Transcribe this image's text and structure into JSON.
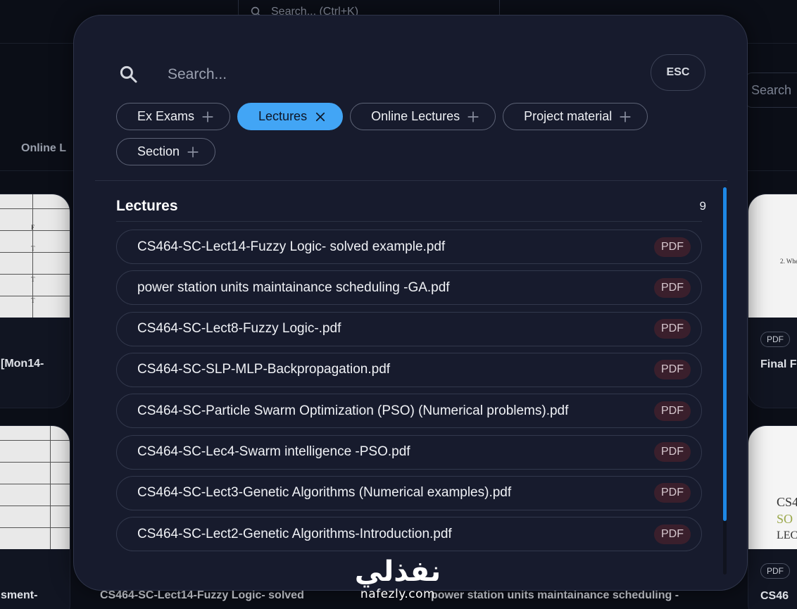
{
  "background": {
    "search_placeholder": "Search... (Ctrl+K)",
    "search2_placeholder": "Search",
    "tab_left": "Online L",
    "card_left_top_title": "[Mon14-",
    "card_right_top_title": "Final F",
    "card_left_bottom_title": "sment-",
    "card_right_bottom_title": "CS46",
    "pdf_chip": "PDF",
    "bottom_text_1": "CS464-SC-Lect14-Fuzzy Logic- solved",
    "bottom_text_2": "power station units maintainance scheduling -"
  },
  "watermark": {
    "arabic": "نفذلي",
    "latin": "nafezly.com"
  },
  "modal": {
    "search_placeholder": "Search...",
    "esc_label": "ESC",
    "chips": [
      {
        "label": "Ex Exams",
        "active": false,
        "icon": "plus-icon"
      },
      {
        "label": "Lectures",
        "active": true,
        "icon": "close-icon"
      },
      {
        "label": "Online Lectures",
        "active": false,
        "icon": "plus-icon"
      },
      {
        "label": "Project material",
        "active": false,
        "icon": "plus-icon"
      },
      {
        "label": "Section",
        "active": false,
        "icon": "plus-icon"
      }
    ],
    "section_title": "Lectures",
    "section_count": "9",
    "results": [
      {
        "name": "CS464-SC-Lect14-Fuzzy Logic- solved example.pdf",
        "type": "PDF"
      },
      {
        "name": "power station units maintainance scheduling -GA.pdf",
        "type": "PDF"
      },
      {
        "name": "CS464-SC-Lect8-Fuzzy Logic-.pdf",
        "type": "PDF"
      },
      {
        "name": "CS464-SC-SLP-MLP-Backpropagation.pdf",
        "type": "PDF"
      },
      {
        "name": "CS464-SC-Particle Swarm Optimization (PSO) (Numerical problems).pdf",
        "type": "PDF"
      },
      {
        "name": "CS464-SC-Lec4-Swarm intelligence -PSO.pdf",
        "type": "PDF"
      },
      {
        "name": "CS464-SC-Lect3-Genetic Algorithms (Numerical examples).pdf",
        "type": "PDF"
      },
      {
        "name": "CS464-SC-Lect2-Genetic Algorithms-Introduction.pdf",
        "type": "PDF"
      }
    ],
    "accent_color": "#42a5f5"
  }
}
